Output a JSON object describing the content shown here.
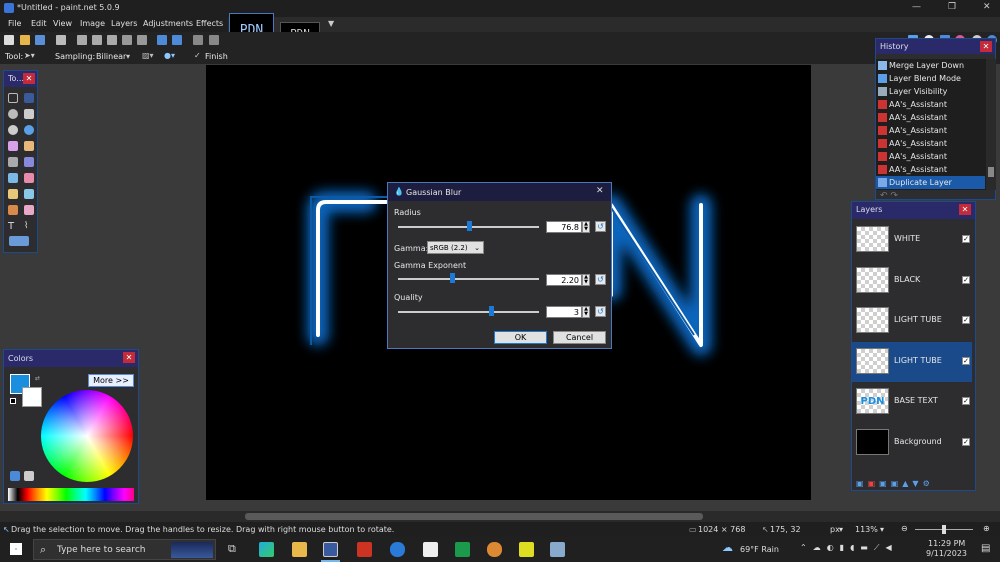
{
  "window": {
    "title": "*Untitled - paint.net 5.0.9"
  },
  "menu": [
    "File",
    "Edit",
    "View",
    "Image",
    "Layers",
    "Adjustments",
    "Effects"
  ],
  "image_tabs": [
    {
      "label": "PDN"
    },
    {
      "label": "PDN"
    }
  ],
  "toolbar": {
    "tool_label": "Tool:",
    "sampling_label": "Sampling:",
    "sampling_value": "Bilinear",
    "finish_label": "Finish"
  },
  "tools_panel": {
    "title": "To..."
  },
  "history_panel": {
    "title": "History",
    "items": [
      "Merge Layer Down",
      "Layer Blend Mode",
      "Layer Visibility",
      "AA's_Assistant",
      "AA's_Assistant",
      "AA's_Assistant",
      "AA's_Assistant",
      "AA's_Assistant",
      "AA's_Assistant",
      "Duplicate Layer"
    ],
    "selected_index": 9
  },
  "layers_panel": {
    "title": "Layers",
    "layers": [
      {
        "name": "WHITE",
        "thumb_text": "",
        "selected": false
      },
      {
        "name": "BLACK",
        "thumb_text": "",
        "selected": false
      },
      {
        "name": "LIGHT TUBE",
        "thumb_text": "",
        "selected": false
      },
      {
        "name": "LIGHT TUBE",
        "thumb_text": "",
        "selected": true
      },
      {
        "name": "BASE TEXT",
        "thumb_text": "PDN",
        "selected": false
      },
      {
        "name": "Background",
        "thumb_text": "",
        "selected": false
      }
    ]
  },
  "colors_panel": {
    "title": "Colors",
    "more_button": "More >>",
    "primary_color": "#1a8fe0",
    "secondary_color": "#ffffff"
  },
  "canvas": {
    "text": "PDN"
  },
  "dialog": {
    "title": "Gaussian Blur",
    "radius_label": "Radius",
    "radius_value": "76.8",
    "radius_fraction": 0.5,
    "gamma_label": "Gamma:",
    "gamma_value": "sRGB (2.2)",
    "gamma_exp_label": "Gamma Exponent",
    "gamma_exp_value": "2.20",
    "gamma_exp_fraction": 0.38,
    "quality_label": "Quality",
    "quality_value": "3",
    "quality_fraction": 0.66,
    "ok_label": "OK",
    "cancel_label": "Cancel"
  },
  "status": {
    "hint": "Drag the selection to move. Drag the handles to resize. Drag with right mouse button to rotate.",
    "image_size": "1024 × 768",
    "cursor_pos": "175, 32",
    "unit": "px",
    "zoom": "113%"
  },
  "taskbar": {
    "search_placeholder": "Type here to search",
    "weather": "69°F Rain",
    "time": "11:29 PM",
    "date": "9/11/2023"
  },
  "colors": {
    "accent": "#1a7ad6",
    "panel_header": "#2a2a6a",
    "close": "#c42b3a"
  }
}
